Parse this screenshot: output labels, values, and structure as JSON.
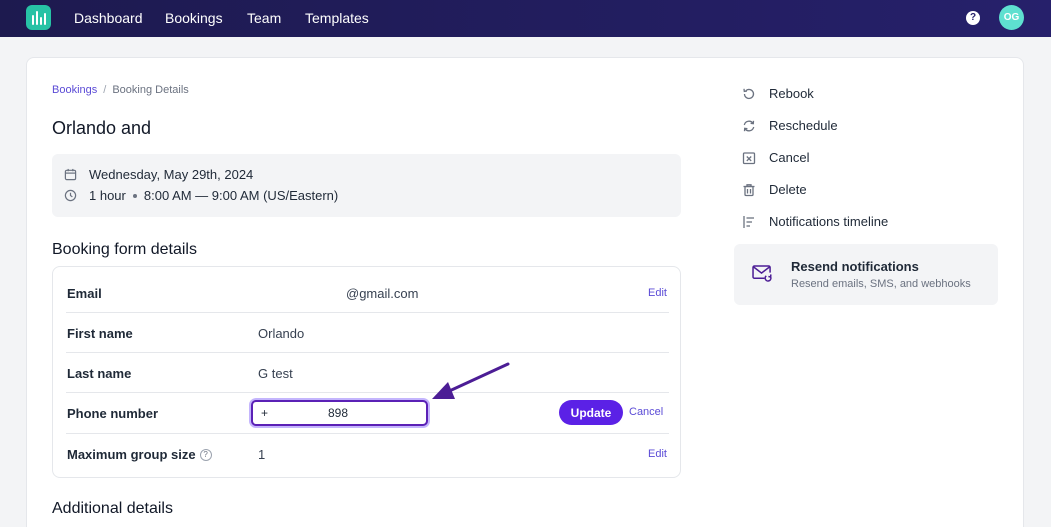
{
  "nav": {
    "links": [
      "Dashboard",
      "Bookings",
      "Team",
      "Templates"
    ],
    "help": "?",
    "avatar_initials": "OG"
  },
  "breadcrumb": {
    "parent": "Bookings",
    "current": "Booking Details"
  },
  "booking": {
    "title": "Orlando and",
    "date": "Wednesday, May 29th, 2024",
    "duration": "1 hour",
    "time": "8:00 AM — 9:00 AM (US/Eastern)"
  },
  "form_section_title": "Booking form details",
  "form": {
    "email_label": "Email",
    "email_value": "@gmail.com",
    "first_name_label": "First name",
    "first_name_value": "Orlando",
    "last_name_label": "Last name",
    "last_name_value": "G test",
    "phone_label": "Phone number",
    "phone_prefix": "+",
    "phone_number": "898",
    "group_label": "Maximum group size",
    "group_value": "1",
    "edit_label": "Edit",
    "update_label": "Update",
    "cancel_label": "Cancel"
  },
  "additional_section_title": "Additional details",
  "actions": [
    "Rebook",
    "Reschedule",
    "Cancel",
    "Delete",
    "Notifications timeline"
  ],
  "resend": {
    "title": "Resend notifications",
    "subtitle": "Resend emails, SMS, and webhooks"
  },
  "colors": {
    "accent": "#5b21e6",
    "link": "#5b4bd6",
    "nav_bg": "#1d1a4f",
    "logo": "#27c2a5"
  }
}
